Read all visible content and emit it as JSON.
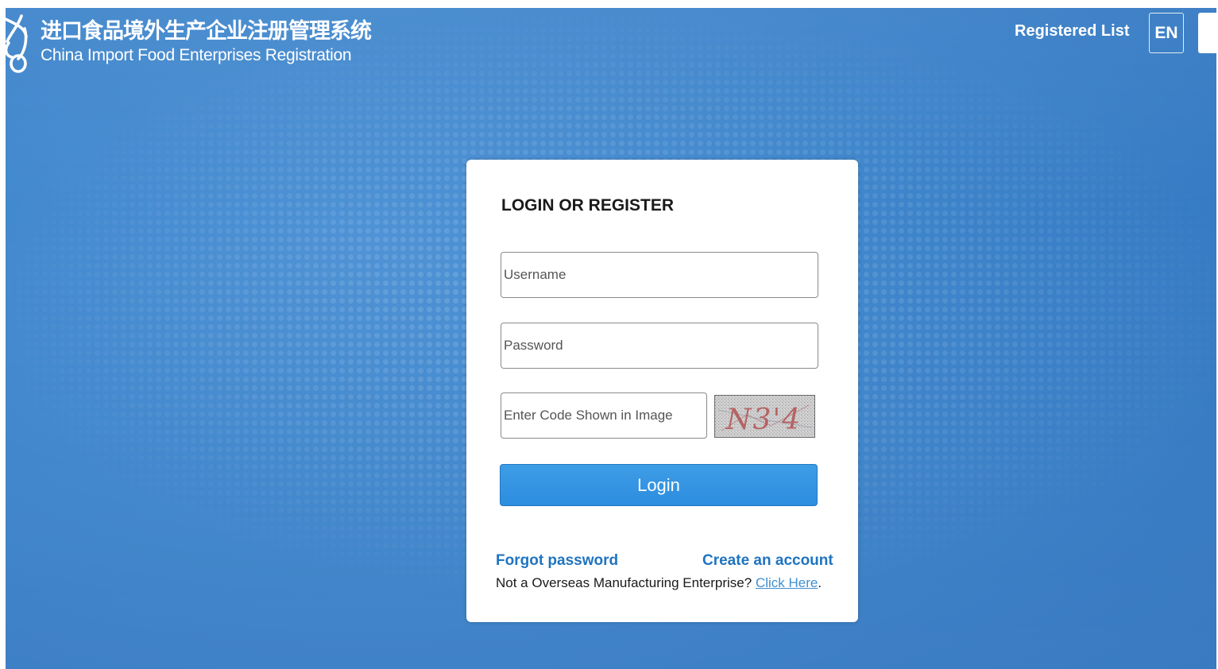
{
  "header": {
    "title_cn": "进口食品境外生产企业注册管理系统",
    "title_en": "China Import Food Enterprises Registration",
    "logo_icon": "knot-logo-icon",
    "registered_list": "Registered List",
    "language": "EN"
  },
  "login_card": {
    "title": "LOGIN OR REGISTER",
    "username": {
      "value": "",
      "placeholder": "Username"
    },
    "password": {
      "value": "",
      "placeholder": "Password"
    },
    "code": {
      "value": "",
      "placeholder": "Enter Code Shown in Image"
    },
    "captcha_text": "N3'4",
    "login_label": "Login",
    "forgot_password": "Forgot password",
    "create_account": "Create an account",
    "not_overseas_text": "Not a Overseas Manufacturing Enterprise? ",
    "click_here": "Click Here",
    "period": "."
  },
  "colors": {
    "background": "#3f86cc",
    "accent": "#2d8ddf",
    "link": "#1f74bf"
  }
}
